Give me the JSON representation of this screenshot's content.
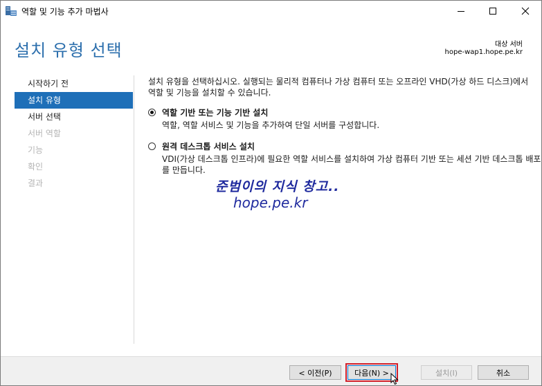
{
  "window": {
    "title": "역할 및 기능 추가 마법사"
  },
  "header": {
    "page_title": "설치 유형 선택",
    "target_label": "대상 서버",
    "target_value": "hope-wap1.hope.pe.kr"
  },
  "nav": {
    "items": [
      {
        "label": "시작하기 전",
        "state": "normal"
      },
      {
        "label": "설치 유형",
        "state": "active"
      },
      {
        "label": "서버 선택",
        "state": "normal"
      },
      {
        "label": "서버 역할",
        "state": "disabled"
      },
      {
        "label": "기능",
        "state": "disabled"
      },
      {
        "label": "확인",
        "state": "disabled"
      },
      {
        "label": "결과",
        "state": "disabled"
      }
    ]
  },
  "content": {
    "intro": "설치 유형을 선택하십시오. 실행되는 물리적 컴퓨터나 가상 컴퓨터 또는 오프라인 VHD(가상 하드 디스크)에서 역할 및 기능을 설치할 수 있습니다.",
    "options": [
      {
        "title": "역할 기반 또는 기능 기반 설치",
        "description": "역할, 역할 서비스 및 기능을 추가하여 단일 서버를 구성합니다.",
        "checked": true
      },
      {
        "title": "원격 데스크톱 서비스 설치",
        "description": "VDI(가상 데스크톱 인프라)에 필요한 역할 서비스를 설치하여 가상 컴퓨터 기반 또는 세션 기반 데스크톱 배포를 만듭니다.",
        "checked": false
      }
    ]
  },
  "watermark": {
    "line1": "준범이의 지식 창고..",
    "line2": "hope.pe.kr"
  },
  "footer": {
    "prev_label": "< 이전(P)",
    "next_label": "다음(N) >",
    "install_label": "설치(I)",
    "cancel_label": "취소"
  },
  "colors": {
    "accent": "#1e6fb8",
    "title": "#2c6fad",
    "highlight_box": "#d21f2a",
    "watermark": "#1f2a9e"
  }
}
